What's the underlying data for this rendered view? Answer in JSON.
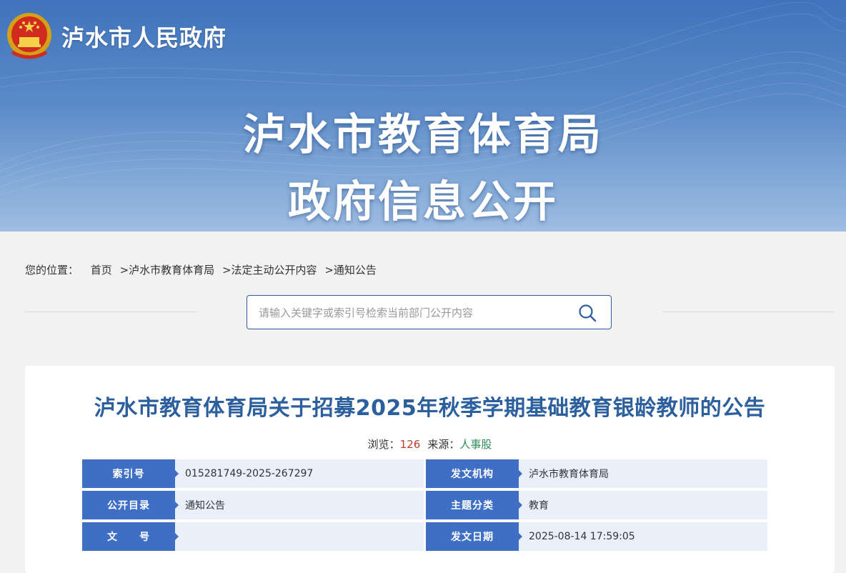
{
  "header": {
    "site_name": "泸水市人民政府",
    "banner_line1": "泸水市教育体育局",
    "banner_line2": "政府信息公开"
  },
  "breadcrumb": {
    "prefix": "您的位置：",
    "items": [
      "首页",
      ">泸水市教育体育局",
      ">法定主动公开内容",
      ">通知公告"
    ]
  },
  "search": {
    "placeholder": "请输入关键字或索引号检索当前部门公开内容",
    "value": ""
  },
  "article": {
    "title": "泸水市教育体育局关于招募2025年秋季学期基础教育银龄教师的公告",
    "views_label": "浏览：",
    "views": "126",
    "source_label": "来源：",
    "source": "人事股"
  },
  "info_table": {
    "rows": [
      [
        {
          "label": "索引号",
          "value": "015281749-2025-267297"
        },
        {
          "label": "发文机构",
          "value": "泸水市教育体育局"
        }
      ],
      [
        {
          "label": "公开目录",
          "value": "通知公告"
        },
        {
          "label": "主题分类",
          "value": "教育"
        }
      ],
      [
        {
          "label": "文　　号",
          "value": ""
        },
        {
          "label": "发文日期",
          "value": "2025-08-14 17:59:05"
        }
      ]
    ]
  },
  "icons": {
    "emblem": "national-emblem-icon",
    "search": "search-icon"
  },
  "colors": {
    "banner": "#4a7cc0",
    "title": "#2c5f9e",
    "label_bg": "#3e6fc5",
    "value_bg": "#eaf0fa",
    "views": "#c0392b",
    "source": "#2e8b57"
  }
}
